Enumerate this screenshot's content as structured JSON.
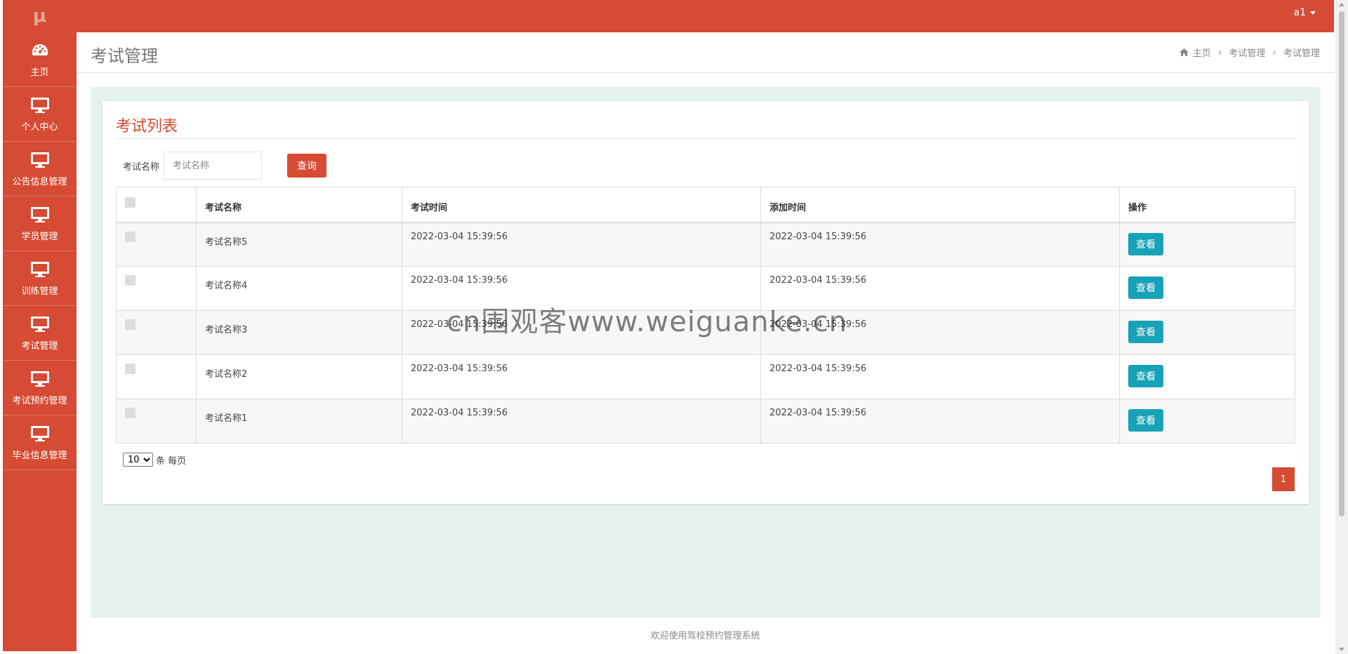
{
  "app": {
    "logo": "μ",
    "user": "a1"
  },
  "sidebar": {
    "items": [
      {
        "label": "主页",
        "icon": "dashboard-icon"
      },
      {
        "label": "个人中心",
        "icon": "monitor-icon"
      },
      {
        "label": "公告信息管理",
        "icon": "monitor-icon"
      },
      {
        "label": "学员管理",
        "icon": "monitor-icon"
      },
      {
        "label": "训练管理",
        "icon": "monitor-icon"
      },
      {
        "label": "考试管理",
        "icon": "monitor-icon"
      },
      {
        "label": "考试预约管理",
        "icon": "monitor-icon"
      },
      {
        "label": "毕业信息管理",
        "icon": "monitor-icon"
      }
    ]
  },
  "header": {
    "title": "考试管理",
    "breadcrumb": [
      "主页",
      "考试管理",
      "考试管理"
    ]
  },
  "card": {
    "title": "考试列表",
    "search": {
      "label": "考试名称",
      "placeholder": "考试名称",
      "value": "",
      "button": "查询"
    },
    "table": {
      "headers": [
        "",
        "考试名称",
        "考试时间",
        "添加时间",
        "操作"
      ],
      "rows": [
        {
          "name": "考试名称5",
          "exam_time": "2022-03-04 15:39:56",
          "added_time": "2022-03-04 15:39:56",
          "action": "查看"
        },
        {
          "name": "考试名称4",
          "exam_time": "2022-03-04 15:39:56",
          "added_time": "2022-03-04 15:39:56",
          "action": "查看"
        },
        {
          "name": "考试名称3",
          "exam_time": "2022-03-04 15:39:56",
          "added_time": "2022-03-04 15:39:56",
          "action": "查看"
        },
        {
          "name": "考试名称2",
          "exam_time": "2022-03-04 15:39:56",
          "added_time": "2022-03-04 15:39:56",
          "action": "查看"
        },
        {
          "name": "考试名称1",
          "exam_time": "2022-03-04 15:39:56",
          "added_time": "2022-03-04 15:39:56",
          "action": "查看"
        }
      ]
    },
    "page_size": {
      "value": "10",
      "options": [
        "10"
      ],
      "suffix": "条 每页"
    },
    "pager": {
      "current": "1"
    }
  },
  "footer": {
    "text": "欢迎使用驾校预约管理系统"
  },
  "watermark": "cn围观客www.weiguanke.cn",
  "colors": {
    "primary": "#d54b33",
    "info": "#17a2b8",
    "content_bg": "#e6f2ec"
  }
}
